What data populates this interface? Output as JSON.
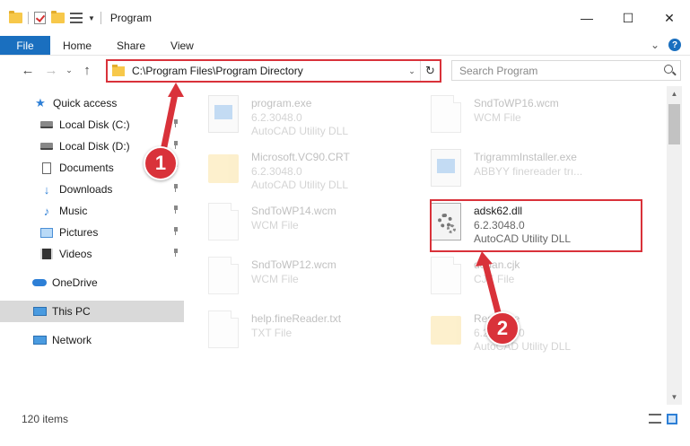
{
  "window": {
    "title": "Program",
    "minimize_label": "—",
    "maximize_label": "☐",
    "close_label": "✕"
  },
  "ribbon": {
    "tabs": [
      "File",
      "Home",
      "Share",
      "View"
    ],
    "expand_label": "⌄",
    "help_label": "?"
  },
  "nav": {
    "back": "←",
    "forward": "→",
    "recent": "⌄",
    "up": "↑"
  },
  "address": {
    "path": "C:\\Program Files\\Program Directory",
    "dropdown": "⌄",
    "refresh": "↻"
  },
  "search": {
    "placeholder": "Search Program"
  },
  "sidebar": {
    "items": [
      {
        "label": "Quick access",
        "icon": "star-icon"
      },
      {
        "label": "Local Disk (C:)",
        "icon": "disk-icon"
      },
      {
        "label": "Local Disk (D:)",
        "icon": "disk-icon"
      },
      {
        "label": "Documents",
        "icon": "documents-icon"
      },
      {
        "label": "Downloads",
        "icon": "downloads-icon"
      },
      {
        "label": "Music",
        "icon": "music-icon"
      },
      {
        "label": "Pictures",
        "icon": "pictures-icon"
      },
      {
        "label": "Videos",
        "icon": "videos-icon"
      },
      {
        "label": "OneDrive",
        "icon": "cloud-icon"
      },
      {
        "label": "This PC",
        "icon": "computer-icon"
      },
      {
        "label": "Network",
        "icon": "network-icon"
      }
    ]
  },
  "files": [
    {
      "name": "program.exe",
      "version": "6.2.3048.0",
      "desc": "AutoCAD Utility DLL"
    },
    {
      "name": "SndToWP16.wcm",
      "version": "WCM File",
      "desc": ""
    },
    {
      "name": "Microsoft.VC90.CRT",
      "version": "6.2.3048.0",
      "desc": "AutoCAD Utility DLL"
    },
    {
      "name": "TrigrammInstaller.exe",
      "version": "ABBYY finereader trı...",
      "desc": ""
    },
    {
      "name": "SndToWP14.wcm",
      "version": "WCM File",
      "desc": ""
    },
    {
      "name": "adsk62.dll",
      "version": "6.2.3048.0",
      "desc": "AutoCAD Utility DLL"
    },
    {
      "name": "SndToWP12.wcm",
      "version": "WCM File",
      "desc": ""
    },
    {
      "name": "deuan.cjk",
      "version": "CJK File",
      "desc": ""
    },
    {
      "name": "help.fineReader.txt",
      "version": "TXT File",
      "desc": ""
    },
    {
      "name": "Resource",
      "version": "6.2.3048.0",
      "desc": "AutoCAD Utility DLL"
    }
  ],
  "status": {
    "count": "120 items"
  },
  "callouts": {
    "one": "1",
    "two": "2"
  },
  "colors": {
    "accent": "#1a6fbf",
    "highlight": "#d9323a"
  }
}
